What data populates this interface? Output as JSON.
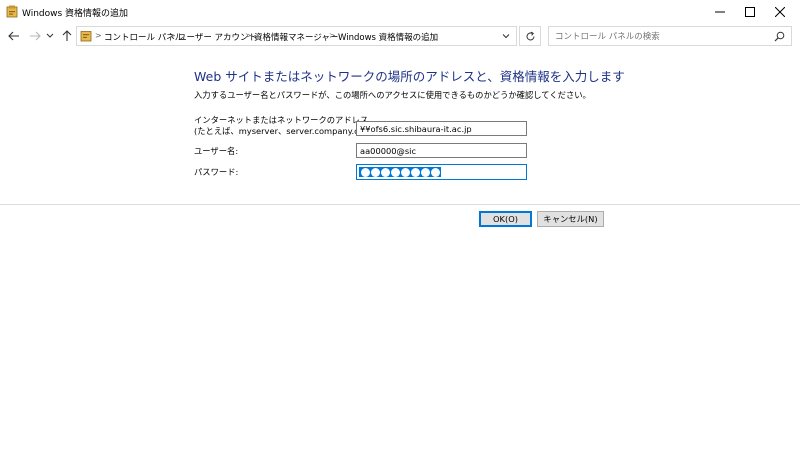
{
  "window": {
    "title": "Windows 資格情報の追加",
    "controls": {
      "minimize": "minimize-icon",
      "maximize": "maximize-icon",
      "close": "close-icon"
    }
  },
  "nav": {
    "back": "back-arrow-icon",
    "forward": "forward-arrow-icon",
    "recent": "chevron-down-icon",
    "up": "up-arrow-icon",
    "breadcrumbs": [
      "コントロール パネル",
      "ユーザー アカウント",
      "資格情報マネージャー",
      "Windows 資格情報の追加"
    ],
    "search_placeholder": "コントロール パネルの検索"
  },
  "main": {
    "heading": "Web サイトまたはネットワークの場所のアドレスと、資格情報を入力します",
    "description": "入力するユーザー名とパスワードが、この場所へのアクセスに使用できるものかどうか確認してください。",
    "address_label_line1": "インターネットまたはネットワークのアドレス",
    "address_label_line2": "(たとえば、myserver、server.company.com):",
    "address_value": "¥¥ofs6.sic.shibaura-it.ac.jp",
    "username_label": "ユーザー名:",
    "username_value": "aa00000@sic",
    "password_label": "パスワード:",
    "password_length": 8
  },
  "buttons": {
    "ok": "OK(O)",
    "cancel": "キャンセル(N)"
  },
  "colors": {
    "heading": "#1e3287",
    "accent": "#0078d7"
  }
}
